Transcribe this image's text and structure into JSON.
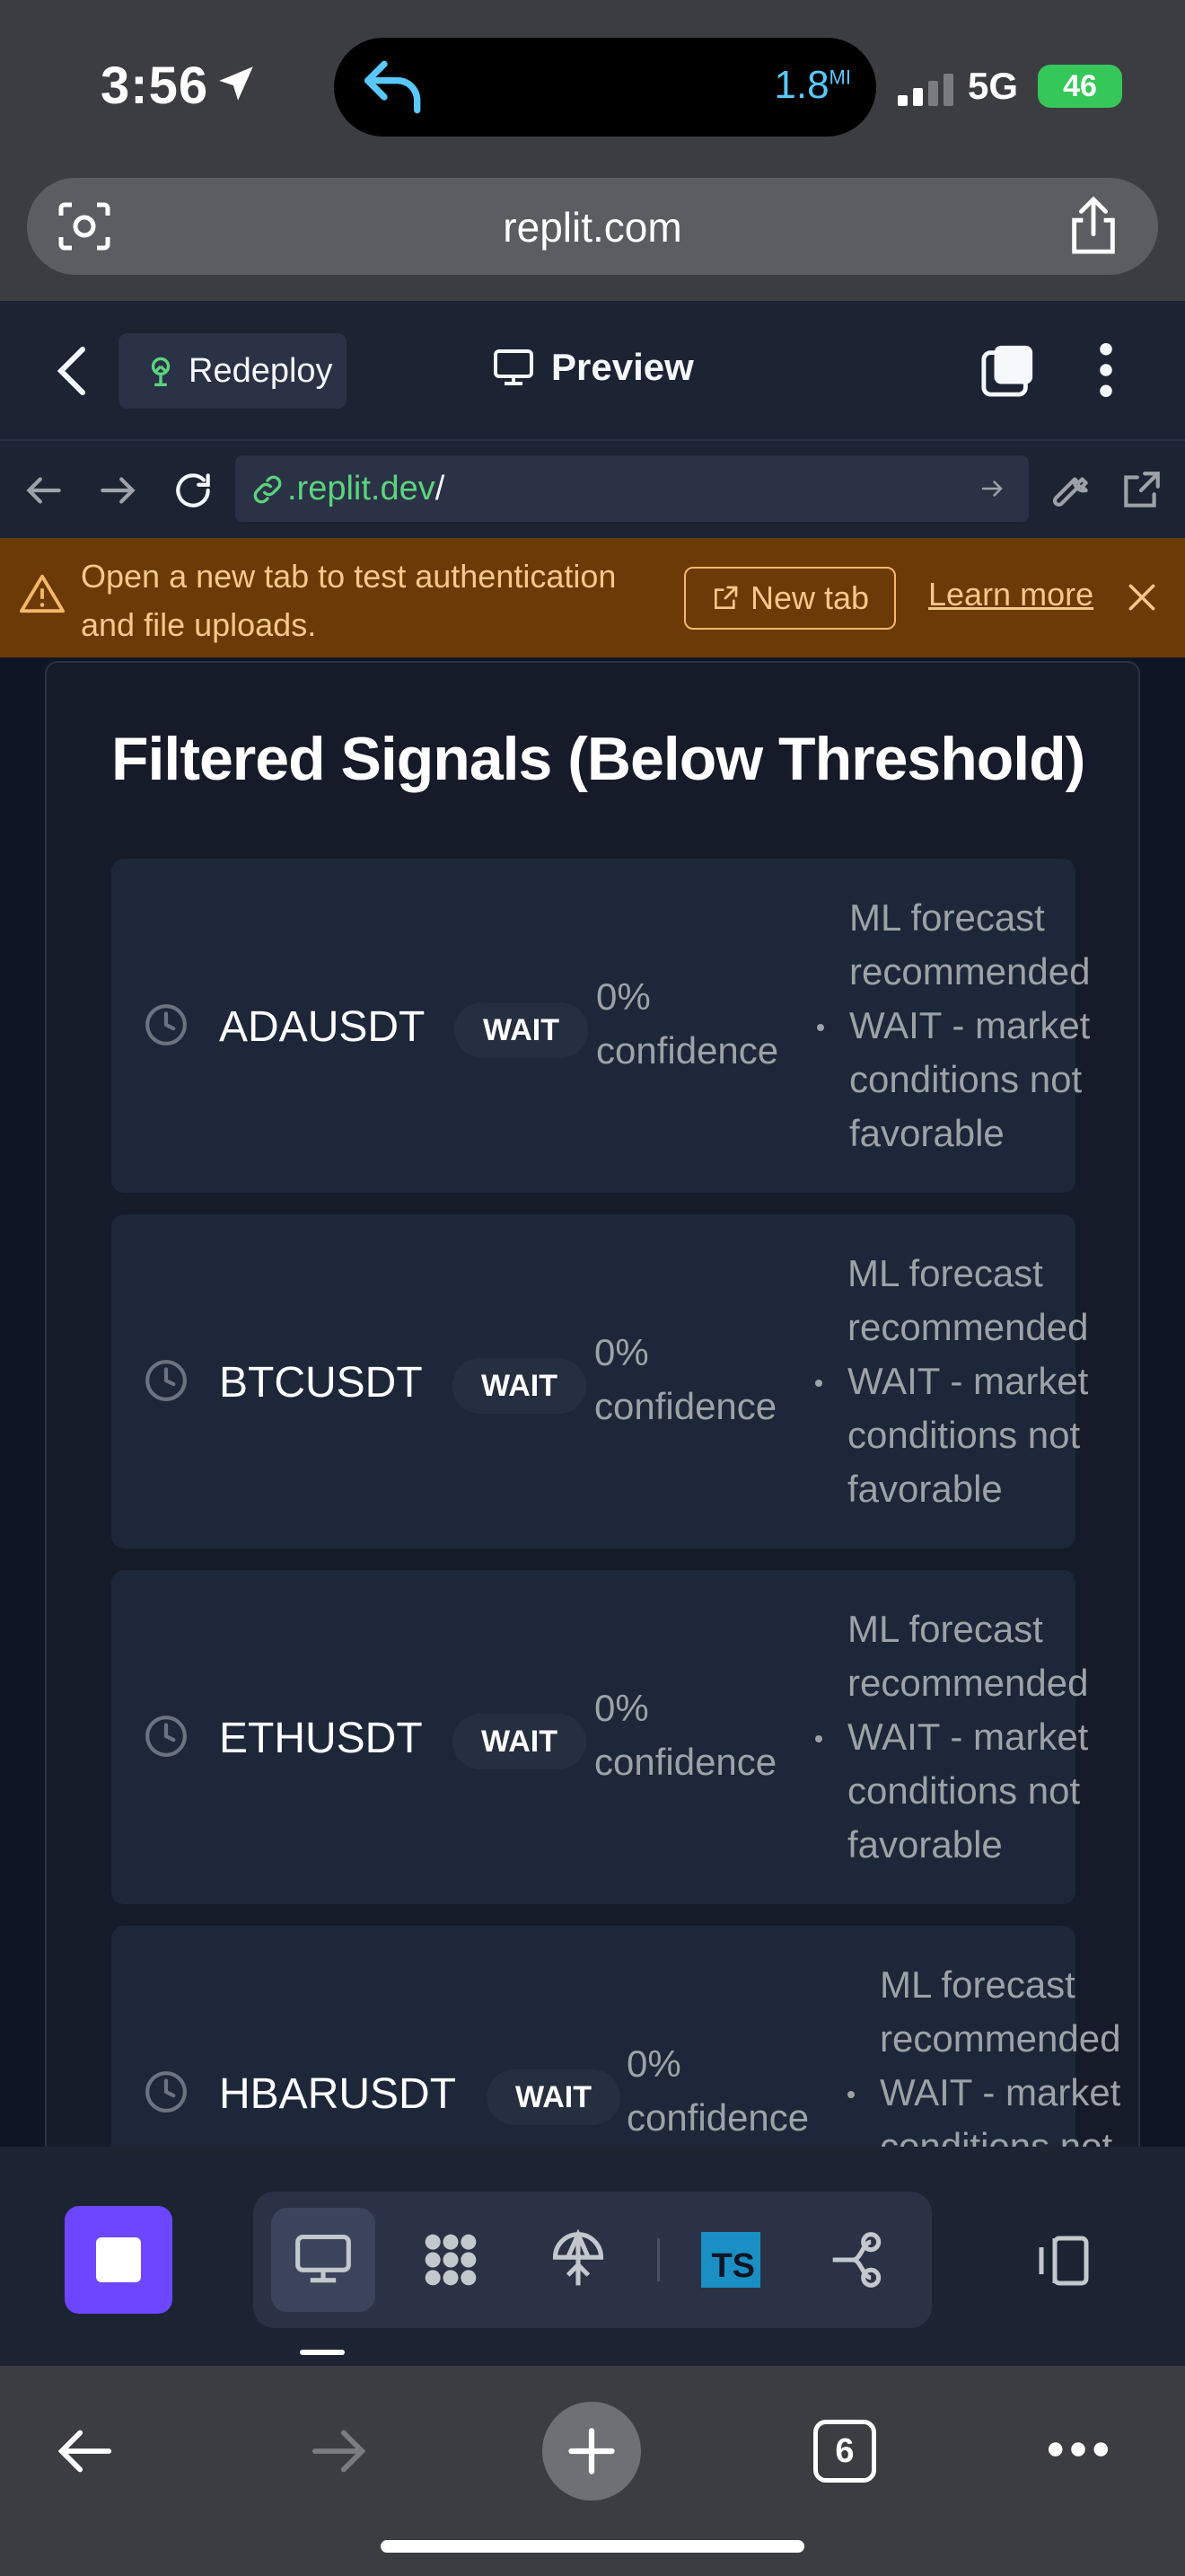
{
  "status_bar": {
    "time": "3:56",
    "island_value": "1.8",
    "island_unit": "MI",
    "network": "5G",
    "battery": "46"
  },
  "browser": {
    "url": "replit.com"
  },
  "replit_header": {
    "redeploy_label": "Redeploy",
    "preview_label": "Preview"
  },
  "address_bar": {
    "domain": ".replit.dev",
    "path": "/"
  },
  "banner": {
    "message": "Open a new tab to test authentication and file uploads.",
    "new_tab_label": "New tab",
    "learn_more_label": "Learn more"
  },
  "main": {
    "title": "Filtered Signals (Below Threshold)",
    "signals": [
      {
        "symbol": "ADAUSDT",
        "action": "WAIT",
        "confidence_value": "0%",
        "confidence_label": "confidence",
        "reason": "ML forecast recommended WAIT - market conditions not favorable"
      },
      {
        "symbol": "BTCUSDT",
        "action": "WAIT",
        "confidence_value": "0%",
        "confidence_label": "confidence",
        "reason": "ML forecast recommended WAIT - market conditions not favorable"
      },
      {
        "symbol": "ETHUSDT",
        "action": "WAIT",
        "confidence_value": "0%",
        "confidence_label": "confidence",
        "reason": "ML forecast recommended WAIT - market conditions not favorable"
      },
      {
        "symbol": "HBARUSDT",
        "action": "WAIT",
        "confidence_value": "0%",
        "confidence_label": "confidence",
        "reason": "ML forecast recommended WAIT - market conditions not favorable"
      }
    ]
  },
  "toolbar": {
    "ts_label": "TS"
  },
  "safari_toolbar": {
    "tab_count": "6"
  },
  "colors": {
    "accent": "#6c47ff",
    "link_green": "#5bd37f",
    "warning_bg": "#6b3a06",
    "card_bg": "#1d2739"
  }
}
